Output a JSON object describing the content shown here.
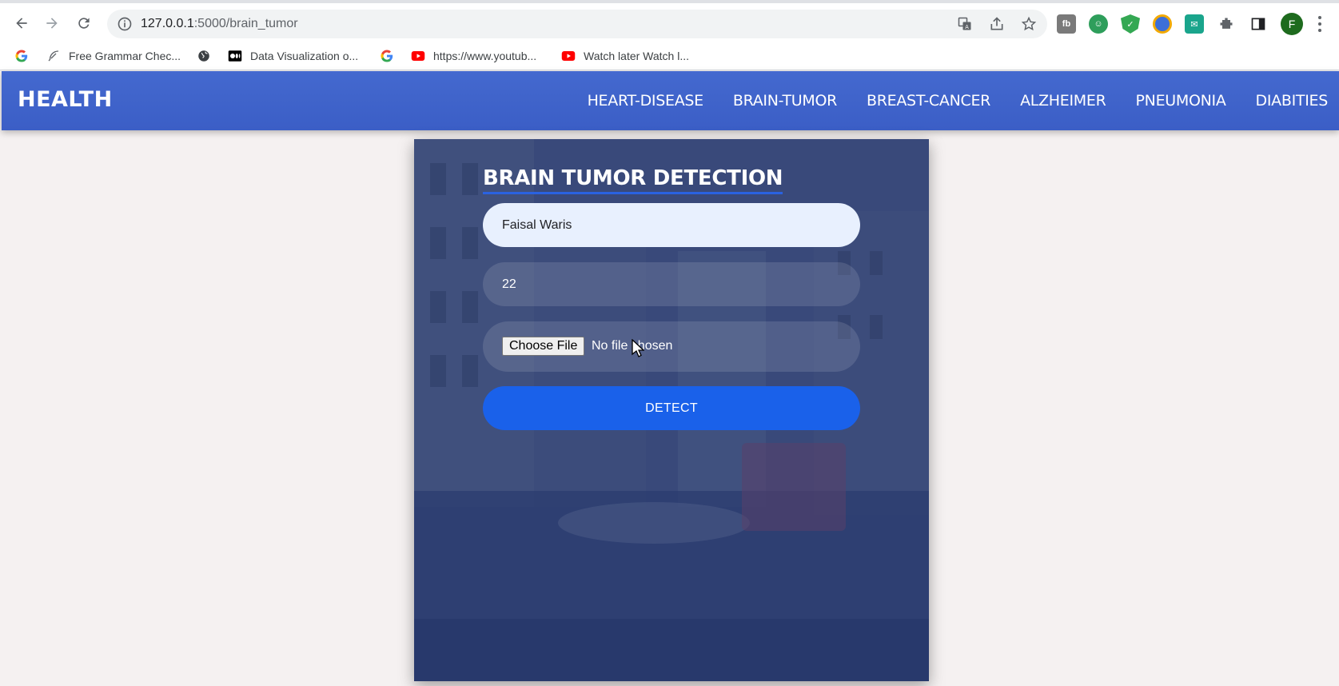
{
  "browser": {
    "url_host": "127.0.0.1",
    "url_path": ":5000/brain_tumor",
    "profile_initial": "F",
    "bookmarks": [
      {
        "icon": "google-icon",
        "label": ""
      },
      {
        "icon": "feather-icon",
        "label": "Free Grammar Chec..."
      },
      {
        "icon": "globe-icon",
        "label": ""
      },
      {
        "icon": "medium-icon",
        "label": "Data Visualization o..."
      },
      {
        "icon": "google-icon",
        "label": ""
      },
      {
        "icon": "youtube-icon",
        "label": "https://www.youtub..."
      },
      {
        "icon": "youtube-icon",
        "label": "Watch later Watch l..."
      }
    ]
  },
  "navbar": {
    "brand": "HEALTH",
    "links": [
      "HEART-DISEASE",
      "BRAIN-TUMOR",
      "BREAST-CANCER",
      "ALZHEIMER",
      "PNEUMONIA",
      "DIABITIES"
    ]
  },
  "form": {
    "title": "BRAIN TUMOR DETECTION",
    "name_value": "Faisal Waris",
    "age_value": "22",
    "choose_file_label": "Choose File",
    "file_status": "No file chosen",
    "detect_label": "DETECT"
  },
  "colors": {
    "navbar": "#3f63cb",
    "detect_button": "#1a61ea",
    "page_background": "#f5f1f1"
  }
}
